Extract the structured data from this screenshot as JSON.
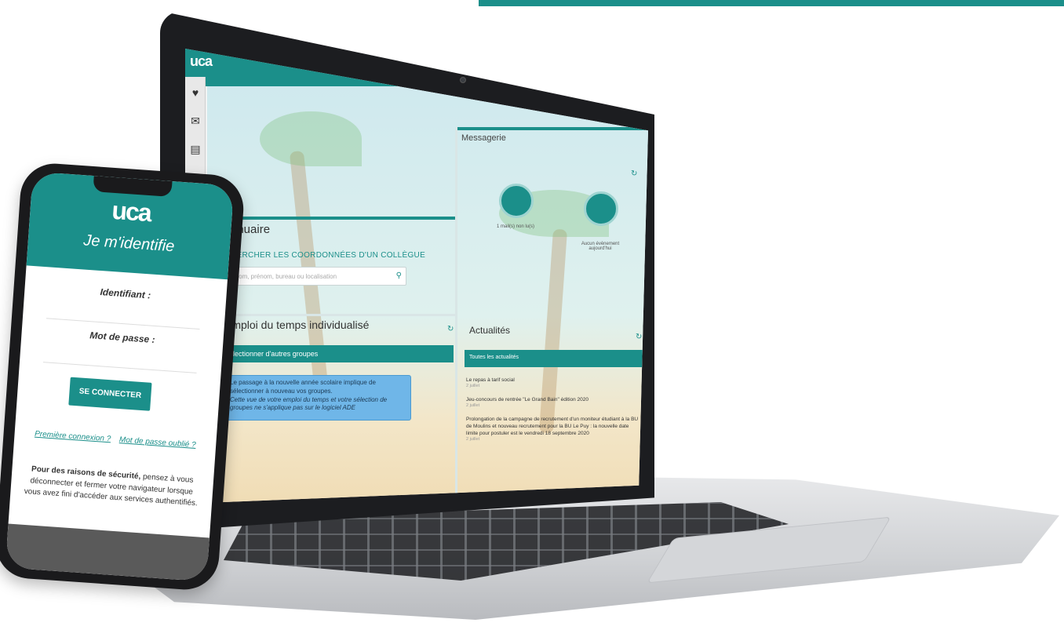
{
  "phone": {
    "logo": "uca",
    "title": "Je m'identifie",
    "username_label": "Identifiant :",
    "password_label": "Mot de passe :",
    "connect_button": "SE CONNECTER",
    "first_login_link": "Première connexion ?",
    "forgot_password_link": "Mot de passe oublié ?",
    "security_note_bold": "Pour des raisons de sécurité,",
    "security_note_text": "pensez à vous déconnecter et fermer votre navigateur lorsque vous avez fini d'accéder aux services authentifiés."
  },
  "laptop": {
    "logo": "uca",
    "annuaire": {
      "title": "nnuaire",
      "subtitle": "HERCHER LES COORDONNÉES D'UN COLLÈGUE",
      "search_placeholder": "ez nom, prénom, bureau ou localisation"
    },
    "messagerie": {
      "title": "Messagerie",
      "mail_caption": "1 mail(s) non lu(s)",
      "calendar_caption": "Aucun évènement aujourd'hui"
    },
    "emploi": {
      "title": "Emploi du temps individualisé",
      "groups_strip": "Sélectionner d'autres groupes",
      "info_text": "Le passage à la nouvelle année scolaire implique de sélectionner à nouveau vos groupes.",
      "info_italic": "Cette vue de votre emploi du temps et votre sélection de groupes ne s'applique pas sur le logiciel ADE"
    },
    "actualites": {
      "title": "Actualités",
      "filter_strip": "Toutes les actualités",
      "items": [
        {
          "title": "Le repas à tarif social",
          "meta": "2 juillet"
        },
        {
          "title": "Jeu-concours de rentrée \"Le Grand Bain\" édition 2020",
          "meta": "2 juillet"
        },
        {
          "title": "Prolongation de la campagne de recrutement d'un moniteur étudiant à la BU de Moulins et nouveau recrutement pour la BU Le Puy : la nouvelle date limite pour postuler est le vendredi 18 septembre 2020",
          "meta": "2 juillet"
        }
      ]
    }
  }
}
